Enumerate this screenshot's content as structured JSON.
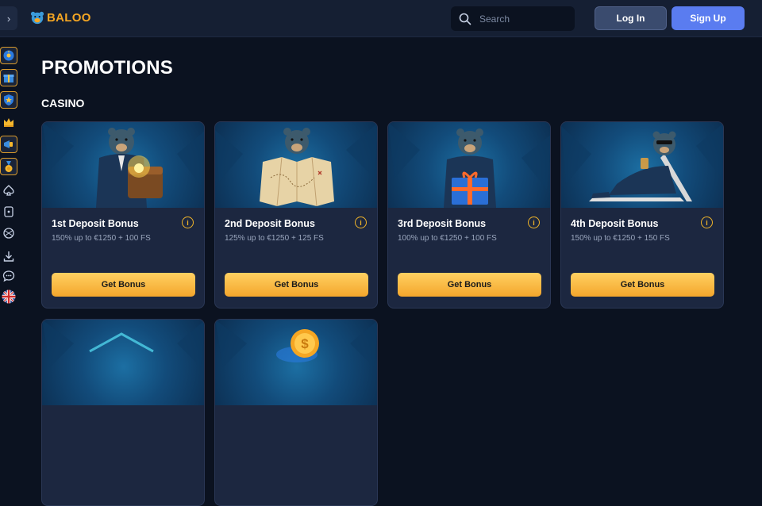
{
  "header": {
    "brand": "BALOO",
    "search_placeholder": "Search",
    "login_label": "Log In",
    "signup_label": "Sign Up"
  },
  "sidebar": {
    "expand_icon": "chevron-right-icon",
    "items": [
      {
        "icon": "wheel-of-fortune-icon"
      },
      {
        "icon": "gift-box-icon"
      },
      {
        "icon": "shield-badge-icon"
      },
      {
        "icon": "crown-icon"
      },
      {
        "icon": "megaphone-icon"
      },
      {
        "icon": "medal-icon"
      },
      {
        "icon": "spade-icon"
      },
      {
        "icon": "dice-icon"
      },
      {
        "icon": "sports-ball-icon"
      },
      {
        "icon": "download-icon"
      },
      {
        "icon": "chat-icon"
      },
      {
        "icon": "uk-flag-icon"
      }
    ]
  },
  "main": {
    "page_title": "PROMOTIONS",
    "section_title": "CASINO",
    "cards": [
      {
        "title": "1st Deposit Bonus",
        "description": "150% up to €1250 + 100 FS",
        "button": "Get Bonus",
        "info": "i",
        "image": "bear-treasure-chest"
      },
      {
        "title": "2nd Deposit Bonus",
        "description": "125% up to €1250 + 125 FS",
        "button": "Get Bonus",
        "info": "i",
        "image": "bear-treasure-map"
      },
      {
        "title": "3rd Deposit Bonus",
        "description": "100% up to €1250 + 100 FS",
        "button": "Get Bonus",
        "info": "i",
        "image": "bear-gift-box"
      },
      {
        "title": "4th Deposit Bonus",
        "description": "150% up to €1250 + 150 FS",
        "button": "Get Bonus",
        "info": "i",
        "image": "bear-sunbed"
      }
    ],
    "lower_cards": [
      {
        "image": "promo-banner-5"
      },
      {
        "image": "coin-dollar",
        "coin_symbol": "$"
      }
    ]
  },
  "colors": {
    "background": "#0b1220",
    "header": "#151f33",
    "card": "#1c2740",
    "accent_orange": "#f4a62c",
    "signup_blue": "#5a7cf0",
    "login_slate": "#3a4b6e"
  }
}
